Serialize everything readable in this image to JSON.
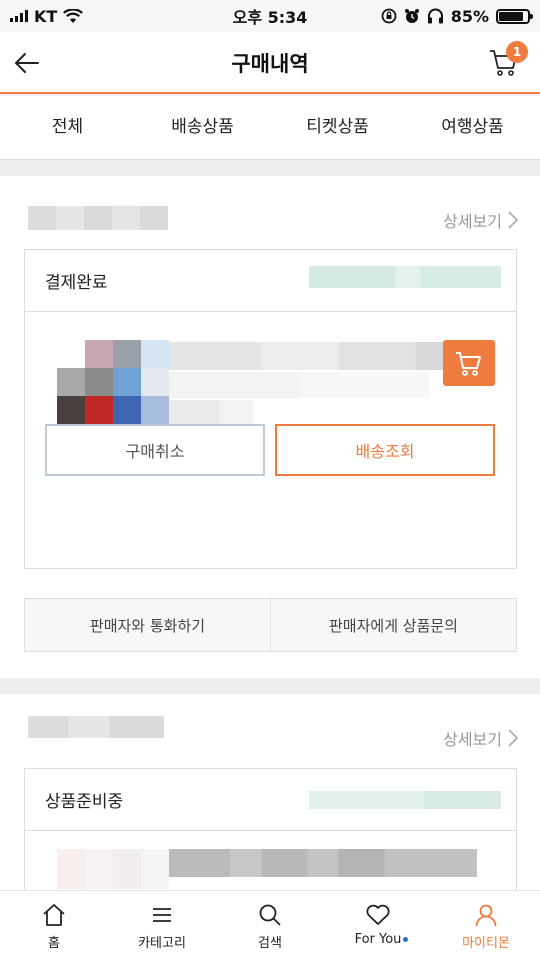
{
  "status_bar": {
    "carrier": "KT",
    "time": "오후 5:34",
    "battery": "85%",
    "battery_level": 0.85
  },
  "header": {
    "title": "구매내역",
    "cart_badge": "1"
  },
  "tabs": [
    {
      "label": "전체",
      "active": true
    },
    {
      "label": "배송상품",
      "active": false
    },
    {
      "label": "티켓상품",
      "active": false
    },
    {
      "label": "여행상품",
      "active": false
    }
  ],
  "orders": [
    {
      "detail_label": "상세보기",
      "status": "결제완료",
      "buttons": {
        "cancel": "구매취소",
        "track": "배송조회"
      },
      "seller_actions": {
        "call": "판매자와 통화하기",
        "inquiry": "판매자에게 상품문의"
      }
    },
    {
      "detail_label": "상세보기",
      "status": "상품준비중"
    }
  ],
  "bottom_nav": [
    {
      "label": "홈",
      "icon": "home-icon"
    },
    {
      "label": "카테고리",
      "icon": "menu-icon"
    },
    {
      "label": "검색",
      "icon": "search-icon"
    },
    {
      "label": "For You",
      "icon": "heart-icon"
    },
    {
      "label": "마이티몬",
      "icon": "person-icon"
    }
  ],
  "colors": {
    "accent": "#f07b3f",
    "cancel_border": "#bccbd8",
    "dot": "#2b6fd6"
  }
}
